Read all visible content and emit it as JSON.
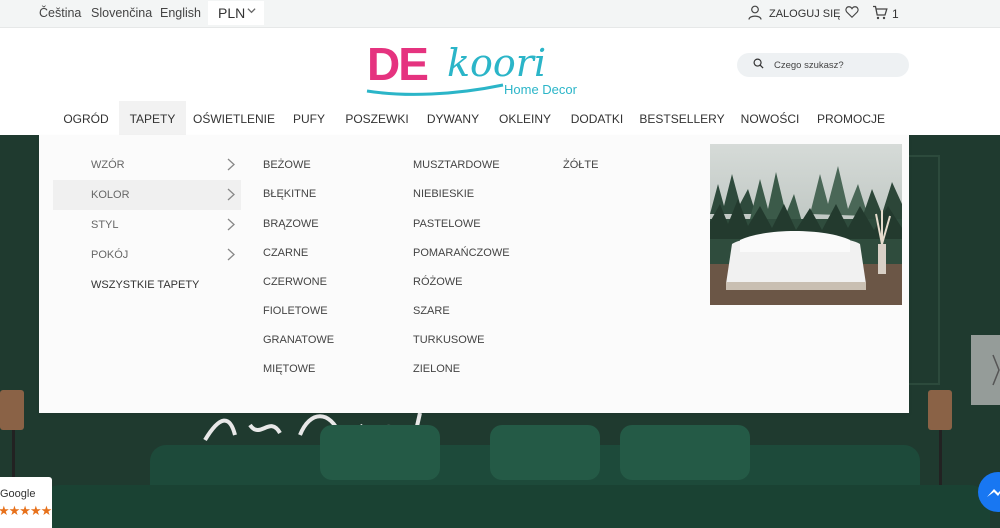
{
  "topbar": {
    "languages": [
      "Čeština",
      "Slovenčina",
      "English"
    ],
    "currency": "PLN",
    "login_label": "ZALOGUJ SIĘ",
    "cart_count": "1"
  },
  "header": {
    "logo": {
      "main_de": "DE",
      "main_koori": "koori",
      "sub": "Home Decor"
    },
    "search_placeholder": "Czego szukasz?"
  },
  "nav": {
    "items": [
      "OGRÓD",
      "TAPETY",
      "OŚWIETLENIE",
      "PUFY",
      "POSZEWKI",
      "DYWANY",
      "OKLEINY",
      "DODATKI",
      "BESTSELLERY",
      "NOWOŚCI",
      "PROMOCJE"
    ],
    "active": "TAPETY"
  },
  "mega_menu": {
    "categories": [
      "WZÓR",
      "KOLOR",
      "STYL",
      "POKÓJ",
      "WSZYSTKIE TAPETY"
    ],
    "active_category": "KOLOR",
    "colors_col1": [
      "BEŻOWE",
      "BŁĘKITNE",
      "BRĄZOWE",
      "CZARNE",
      "CZERWONE",
      "FIOLETOWE",
      "GRANATOWE",
      "MIĘTOWE"
    ],
    "colors_col2": [
      "MUSZTARDOWE",
      "NIEBIESKIE",
      "PASTELOWE",
      "POMARAŃCZOWE",
      "RÓŻOWE",
      "SZARE",
      "TURKUSOWE",
      "ZIELONE"
    ],
    "colors_col3": [
      "ŻÓŁTE"
    ]
  },
  "google_badge": {
    "label": "Google",
    "stars": "★★★★★"
  },
  "colors": {
    "brand_pink": "#e5337f",
    "brand_teal": "#2bb5c8",
    "hero_green": "#1f3a2f"
  },
  "icons": [
    "user-icon",
    "heart-icon",
    "cart-icon",
    "search-icon",
    "chevron-down-icon",
    "chevron-right-icon",
    "messenger-icon"
  ]
}
